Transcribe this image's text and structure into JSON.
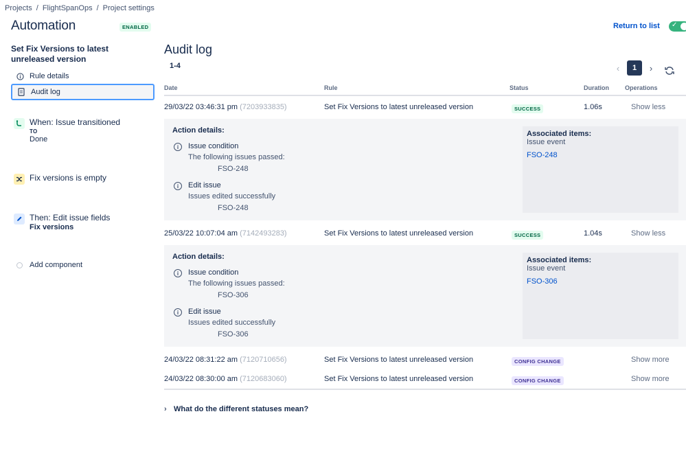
{
  "breadcrumbs": [
    "Projects",
    "FlightSpanOps",
    "Project settings"
  ],
  "breadcrumb_separator": "/",
  "header": {
    "title": "Automation",
    "status_badge": "ENABLED",
    "return_link": "Return to list",
    "enabled_toggle": true
  },
  "sidebar": {
    "rule_name": "Set Fix Versions to latest unreleased version",
    "items": [
      {
        "label": "Rule details",
        "icon": "info-icon"
      },
      {
        "label": "Audit log",
        "icon": "document-icon",
        "active": true
      }
    ],
    "components": [
      {
        "icon": "transition-icon",
        "title": "When: Issue transitioned",
        "sub_label": "TO",
        "sub_value": "Done"
      },
      {
        "icon": "shuffle-icon",
        "title": "Fix versions is empty"
      },
      {
        "icon": "pencil-icon",
        "title": "Then: Edit issue fields",
        "sub_value_bold": "Fix versions"
      }
    ],
    "add_component": "Add component"
  },
  "main": {
    "title": "Audit log",
    "range": "1-4",
    "pagination": {
      "current_page": "1",
      "prev": "‹",
      "next": "›"
    },
    "columns": {
      "date": "Date",
      "rule": "Rule",
      "status": "Status",
      "duration": "Duration",
      "operations": "Operations"
    },
    "rows": [
      {
        "date": "29/03/22 03:46:31 pm",
        "id": "(7203933835)",
        "rule": "Set Fix Versions to latest unreleased version",
        "status": "SUCCESS",
        "duration": "1.06s",
        "operation": "Show less",
        "details": {
          "label": "Action details:",
          "items": [
            {
              "title": "Issue condition",
              "desc": "The following issues passed:",
              "key": "FSO-248"
            },
            {
              "title": "Edit issue",
              "desc": "Issues edited successfully",
              "key": "FSO-248"
            }
          ],
          "assoc_label": "Associated items:",
          "assoc_event": "Issue event",
          "assoc_key": "FSO-248"
        }
      },
      {
        "date": "25/03/22 10:07:04 am",
        "id": "(7142493283)",
        "rule": "Set Fix Versions to latest unreleased version",
        "status": "SUCCESS",
        "duration": "1.04s",
        "operation": "Show less",
        "details": {
          "label": "Action details:",
          "items": [
            {
              "title": "Issue condition",
              "desc": "The following issues passed:",
              "key": "FSO-306"
            },
            {
              "title": "Edit issue",
              "desc": "Issues edited successfully",
              "key": "FSO-306"
            }
          ],
          "assoc_label": "Associated items:",
          "assoc_event": "Issue event",
          "assoc_key": "FSO-306"
        }
      },
      {
        "date": "24/03/22 08:31:22 am",
        "id": "(7120710656)",
        "rule": "Set Fix Versions to latest unreleased version",
        "status": "CONFIG CHANGE",
        "duration": "",
        "operation": "Show more"
      },
      {
        "date": "24/03/22 08:30:00 am",
        "id": "(7120683060)",
        "rule": "Set Fix Versions to latest unreleased version",
        "status": "CONFIG CHANGE",
        "duration": "",
        "operation": "Show more"
      }
    ],
    "statuses_help": "What do the different statuses mean?"
  },
  "colors": {
    "accent": "#0052cc",
    "success": "#006644",
    "config": "#403294",
    "toggle": "#36b37e"
  }
}
